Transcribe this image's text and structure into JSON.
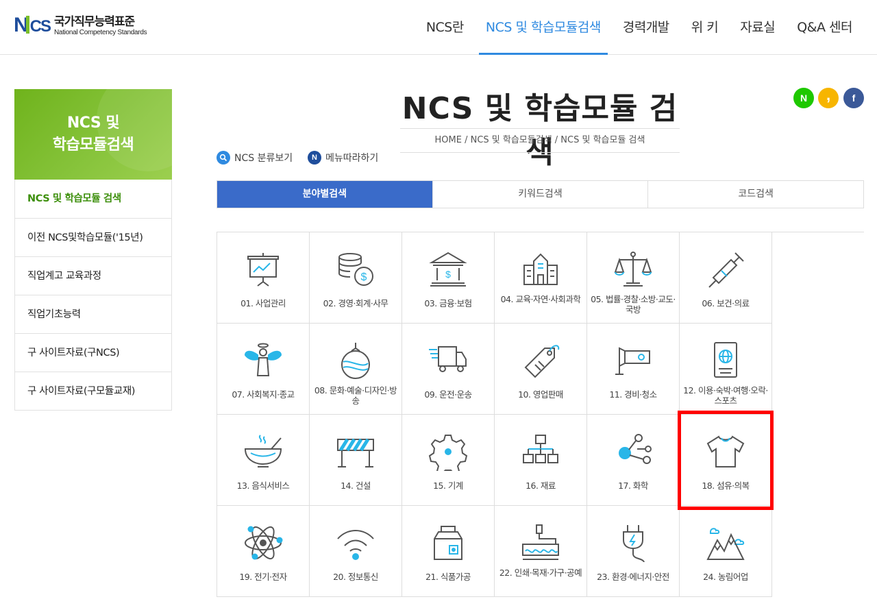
{
  "header": {
    "logo_kr": "국가직무능력표준",
    "logo_en": "National Competency Standards",
    "nav": [
      "NCS란",
      "NCS 및 학습모듈검색",
      "경력개발",
      "위 키",
      "자료실",
      "Q&A 센터"
    ],
    "nav_active": 1
  },
  "sidebar": {
    "title_line1": "NCS 및",
    "title_line2": "학습모듈검색",
    "items": [
      {
        "label": "NCS 및 학습모듈 검색",
        "active": true
      },
      {
        "label": "이전 NCS및학습모듈('15년)"
      },
      {
        "label": "직업계고 교육과정"
      },
      {
        "label": "직업기초능력"
      },
      {
        "label": "구 사이트자료(구NCS)"
      },
      {
        "label": "구 사이트자료(구모듈교재)"
      }
    ]
  },
  "page": {
    "title": "NCS 및 학습모듈 검색",
    "breadcrumb": "HOME / NCS 및 학습모듈검색 / NCS 및 학습모듈 검색"
  },
  "quick_links": {
    "classify": "NCS 분류보기",
    "follow": "메뉴따라하기"
  },
  "social": {
    "naver": "N",
    "kakao": ",",
    "facebook": "f"
  },
  "tabs": [
    "분야별검색",
    "키워드검색",
    "코드검색"
  ],
  "categories": [
    {
      "label": "01. 사업관리",
      "icon": "presentation-board-icon"
    },
    {
      "label": "02. 경영·회계·사무",
      "icon": "coins-dollar-icon"
    },
    {
      "label": "03. 금융·보험",
      "icon": "bank-icon"
    },
    {
      "label": "04. 교육·자연·사회과학",
      "icon": "school-building-icon"
    },
    {
      "label": "05. 법률·경찰·소방·교도·국방",
      "icon": "scales-icon"
    },
    {
      "label": "06. 보건·의료",
      "icon": "syringe-icon"
    },
    {
      "label": "07. 사회복지·종교",
      "icon": "angel-icon"
    },
    {
      "label": "08. 문화·예술·디자인·방송",
      "icon": "ornament-icon"
    },
    {
      "label": "09. 운전·운송",
      "icon": "truck-icon"
    },
    {
      "label": "10. 영업판매",
      "icon": "price-tag-icon"
    },
    {
      "label": "11. 경비·청소",
      "icon": "cctv-camera-icon"
    },
    {
      "label": "12. 이용·숙박·여행·오락·스포츠",
      "icon": "passport-icon"
    },
    {
      "label": "13. 음식서비스",
      "icon": "food-bowl-icon"
    },
    {
      "label": "14. 건설",
      "icon": "construction-barrier-icon"
    },
    {
      "label": "15. 기계",
      "icon": "gear-icon"
    },
    {
      "label": "16. 재료",
      "icon": "hierarchy-icon"
    },
    {
      "label": "17. 화학",
      "icon": "molecule-icon"
    },
    {
      "label": "18. 섬유·의복",
      "icon": "tshirt-icon"
    },
    {
      "label": "19. 전기·전자",
      "icon": "atom-icon"
    },
    {
      "label": "20. 정보통신",
      "icon": "wifi-icon"
    },
    {
      "label": "21. 식품가공",
      "icon": "milk-carton-icon"
    },
    {
      "label": "22. 인쇄·목재·가구·공예",
      "icon": "paint-roller-icon"
    },
    {
      "label": "23. 환경·에너지·안전",
      "icon": "power-plug-icon"
    },
    {
      "label": "24. 농림어업",
      "icon": "mountains-icon"
    }
  ],
  "colors": {
    "accent_blue": "#2f8ae0",
    "tab_active": "#3a6bc9",
    "sidebar_green": "#7bbf2a",
    "icon_cyan": "#29b6e8",
    "highlight_red": "#ff0000"
  }
}
